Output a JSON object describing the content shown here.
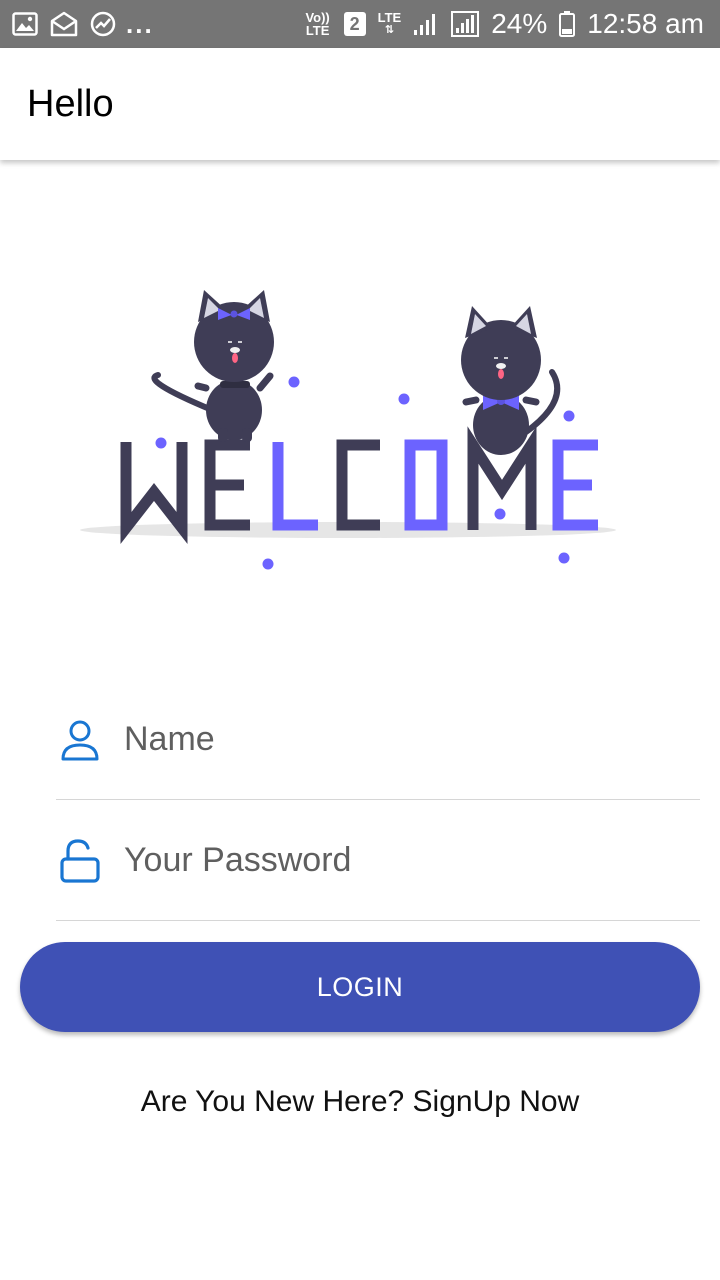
{
  "status_bar": {
    "more_indicator": "...",
    "volte": "Vo)) LTE",
    "sim_slot": "2",
    "network": "LTE",
    "battery_percent": "24%",
    "time": "12:58 am",
    "icons": [
      "image-icon",
      "mail-open-icon",
      "trending-icon",
      "volte-icon",
      "sim-2-icon",
      "lte-data-icon",
      "signal-icon",
      "signal-icon",
      "battery-icon"
    ]
  },
  "app_bar": {
    "title": "Hello"
  },
  "illustration": {
    "word_dark_1": "WE",
    "word_accent_1": "L",
    "word_dark_2": "C",
    "word_accent_2": "O",
    "word_dark_3": "M",
    "word_accent_3": "E",
    "accent_color": "#6c63ff",
    "dark_color": "#3f3d56"
  },
  "form": {
    "name_placeholder": "Name",
    "password_placeholder": "Your Password",
    "name_icon": "person-icon",
    "password_icon": "lock-open-icon",
    "icon_color": "#1976d2"
  },
  "login_button": {
    "label": "LOGIN",
    "color": "#3f51b5"
  },
  "signup": {
    "text": "Are You New Here? SignUp Now"
  }
}
